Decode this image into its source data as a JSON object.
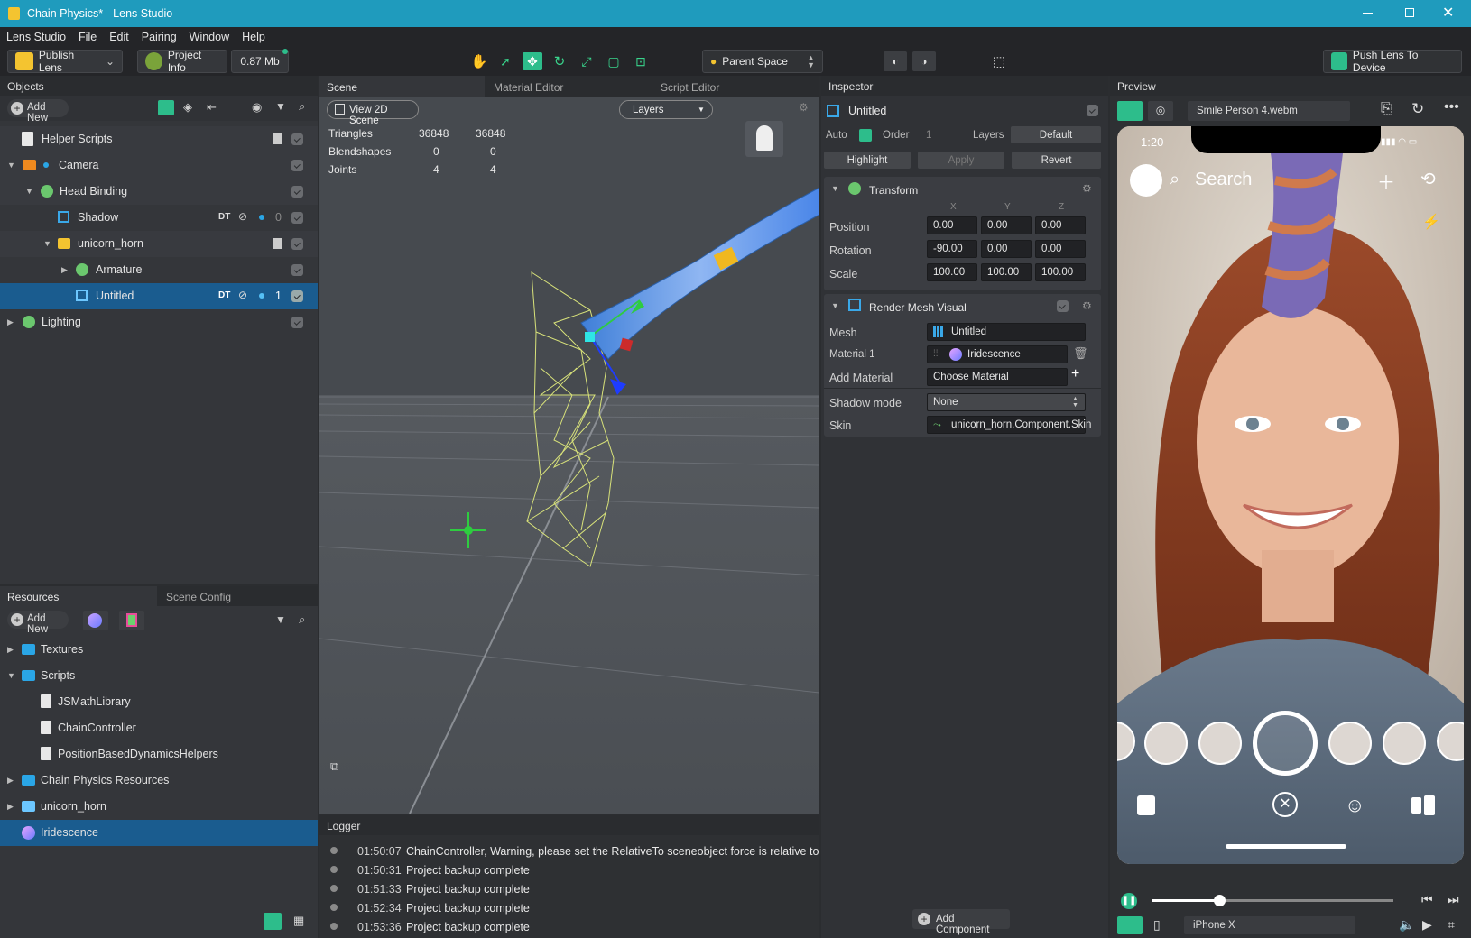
{
  "window": {
    "title": "Chain Physics* - Lens Studio",
    "controls": [
      "minimize-icon",
      "maximize-icon",
      "close-icon"
    ]
  },
  "menu": [
    "Lens Studio",
    "File",
    "Edit",
    "Pairing",
    "Window",
    "Help"
  ],
  "toolbar": {
    "publish_label": "Publish Lens",
    "project_info_label": "Project Info",
    "size_label": "0.87 Mb",
    "space_label": "Parent Space",
    "push_label": "Push Lens To Device"
  },
  "objects": {
    "header": "Objects",
    "add_new": "Add New",
    "items": [
      {
        "label": "Helper Scripts"
      },
      {
        "label": "Camera"
      },
      {
        "label": "Head Binding"
      },
      {
        "label": "Shadow",
        "tag": "DT",
        "count": "0"
      },
      {
        "label": "unicorn_horn"
      },
      {
        "label": "Armature"
      },
      {
        "label": "Untitled",
        "tag": "DT",
        "count": "1"
      },
      {
        "label": "Lighting"
      }
    ]
  },
  "resources": {
    "tab_resources": "Resources",
    "tab_scene_config": "Scene Config",
    "add_new": "Add New",
    "items": [
      {
        "label": "Textures"
      },
      {
        "label": "Scripts"
      },
      {
        "label": "JSMathLibrary"
      },
      {
        "label": "ChainController"
      },
      {
        "label": "PositionBasedDynamicsHelpers"
      },
      {
        "label": "Chain Physics Resources"
      },
      {
        "label": "unicorn_horn"
      },
      {
        "label": "Iridescence"
      }
    ]
  },
  "scene": {
    "tab_scene": "Scene",
    "tab_material": "Material Editor",
    "tab_script": "Script Editor",
    "view2d": "View 2D Scene",
    "layers": "Layers",
    "stats": [
      {
        "name": "Triangles",
        "a": "36848",
        "b": "36848"
      },
      {
        "name": "Blendshapes",
        "a": "0",
        "b": "0"
      },
      {
        "name": "Joints",
        "a": "4",
        "b": "4"
      }
    ]
  },
  "logger": {
    "header": "Logger",
    "rows": [
      {
        "time": "01:50:07",
        "msg": "ChainController, Warning, please set the RelativeTo sceneobject force is relative to"
      },
      {
        "time": "01:50:31",
        "msg": "Project backup complete"
      },
      {
        "time": "01:51:33",
        "msg": "Project backup complete"
      },
      {
        "time": "01:52:34",
        "msg": "Project backup complete"
      },
      {
        "time": "01:53:36",
        "msg": "Project backup complete"
      }
    ]
  },
  "inspector": {
    "header": "Inspector",
    "object_name": "Untitled",
    "auto": "Auto",
    "order": "Order",
    "order_value": "1",
    "layers": "Layers",
    "default_btn": "Default",
    "highlight_btn": "Highlight",
    "apply_btn": "Apply",
    "revert_btn": "Revert",
    "transform": {
      "title": "Transform",
      "axes": [
        "X",
        "Y",
        "Z"
      ],
      "rows": [
        {
          "label": "Position",
          "values": [
            "0.00",
            "0.00",
            "0.00"
          ]
        },
        {
          "label": "Rotation",
          "values": [
            "-90.00",
            "0.00",
            "0.00"
          ]
        },
        {
          "label": "Scale",
          "values": [
            "100.00",
            "100.00",
            "100.00"
          ]
        }
      ]
    },
    "render_mesh": {
      "title": "Render Mesh Visual",
      "mesh_label": "Mesh",
      "mesh_value": "Untitled",
      "material_label": "Material 1",
      "material_value": "Iridescence",
      "add_material_label": "Add Material",
      "add_material_value": "Choose Material",
      "shadow_label": "Shadow mode",
      "shadow_value": "None",
      "skin_label": "Skin",
      "skin_value": "unicorn_horn.Component.Skin"
    },
    "add_component": "Add Component"
  },
  "preview": {
    "header": "Preview",
    "video": "Smile Person 4.webm",
    "clock": "1:20",
    "search": "Search",
    "device": "iPhone X",
    "progress": 0.28
  },
  "colors": {
    "accent": "#1f9bbd",
    "selection": "#1a5c8f",
    "green": "#2dbd8b"
  }
}
